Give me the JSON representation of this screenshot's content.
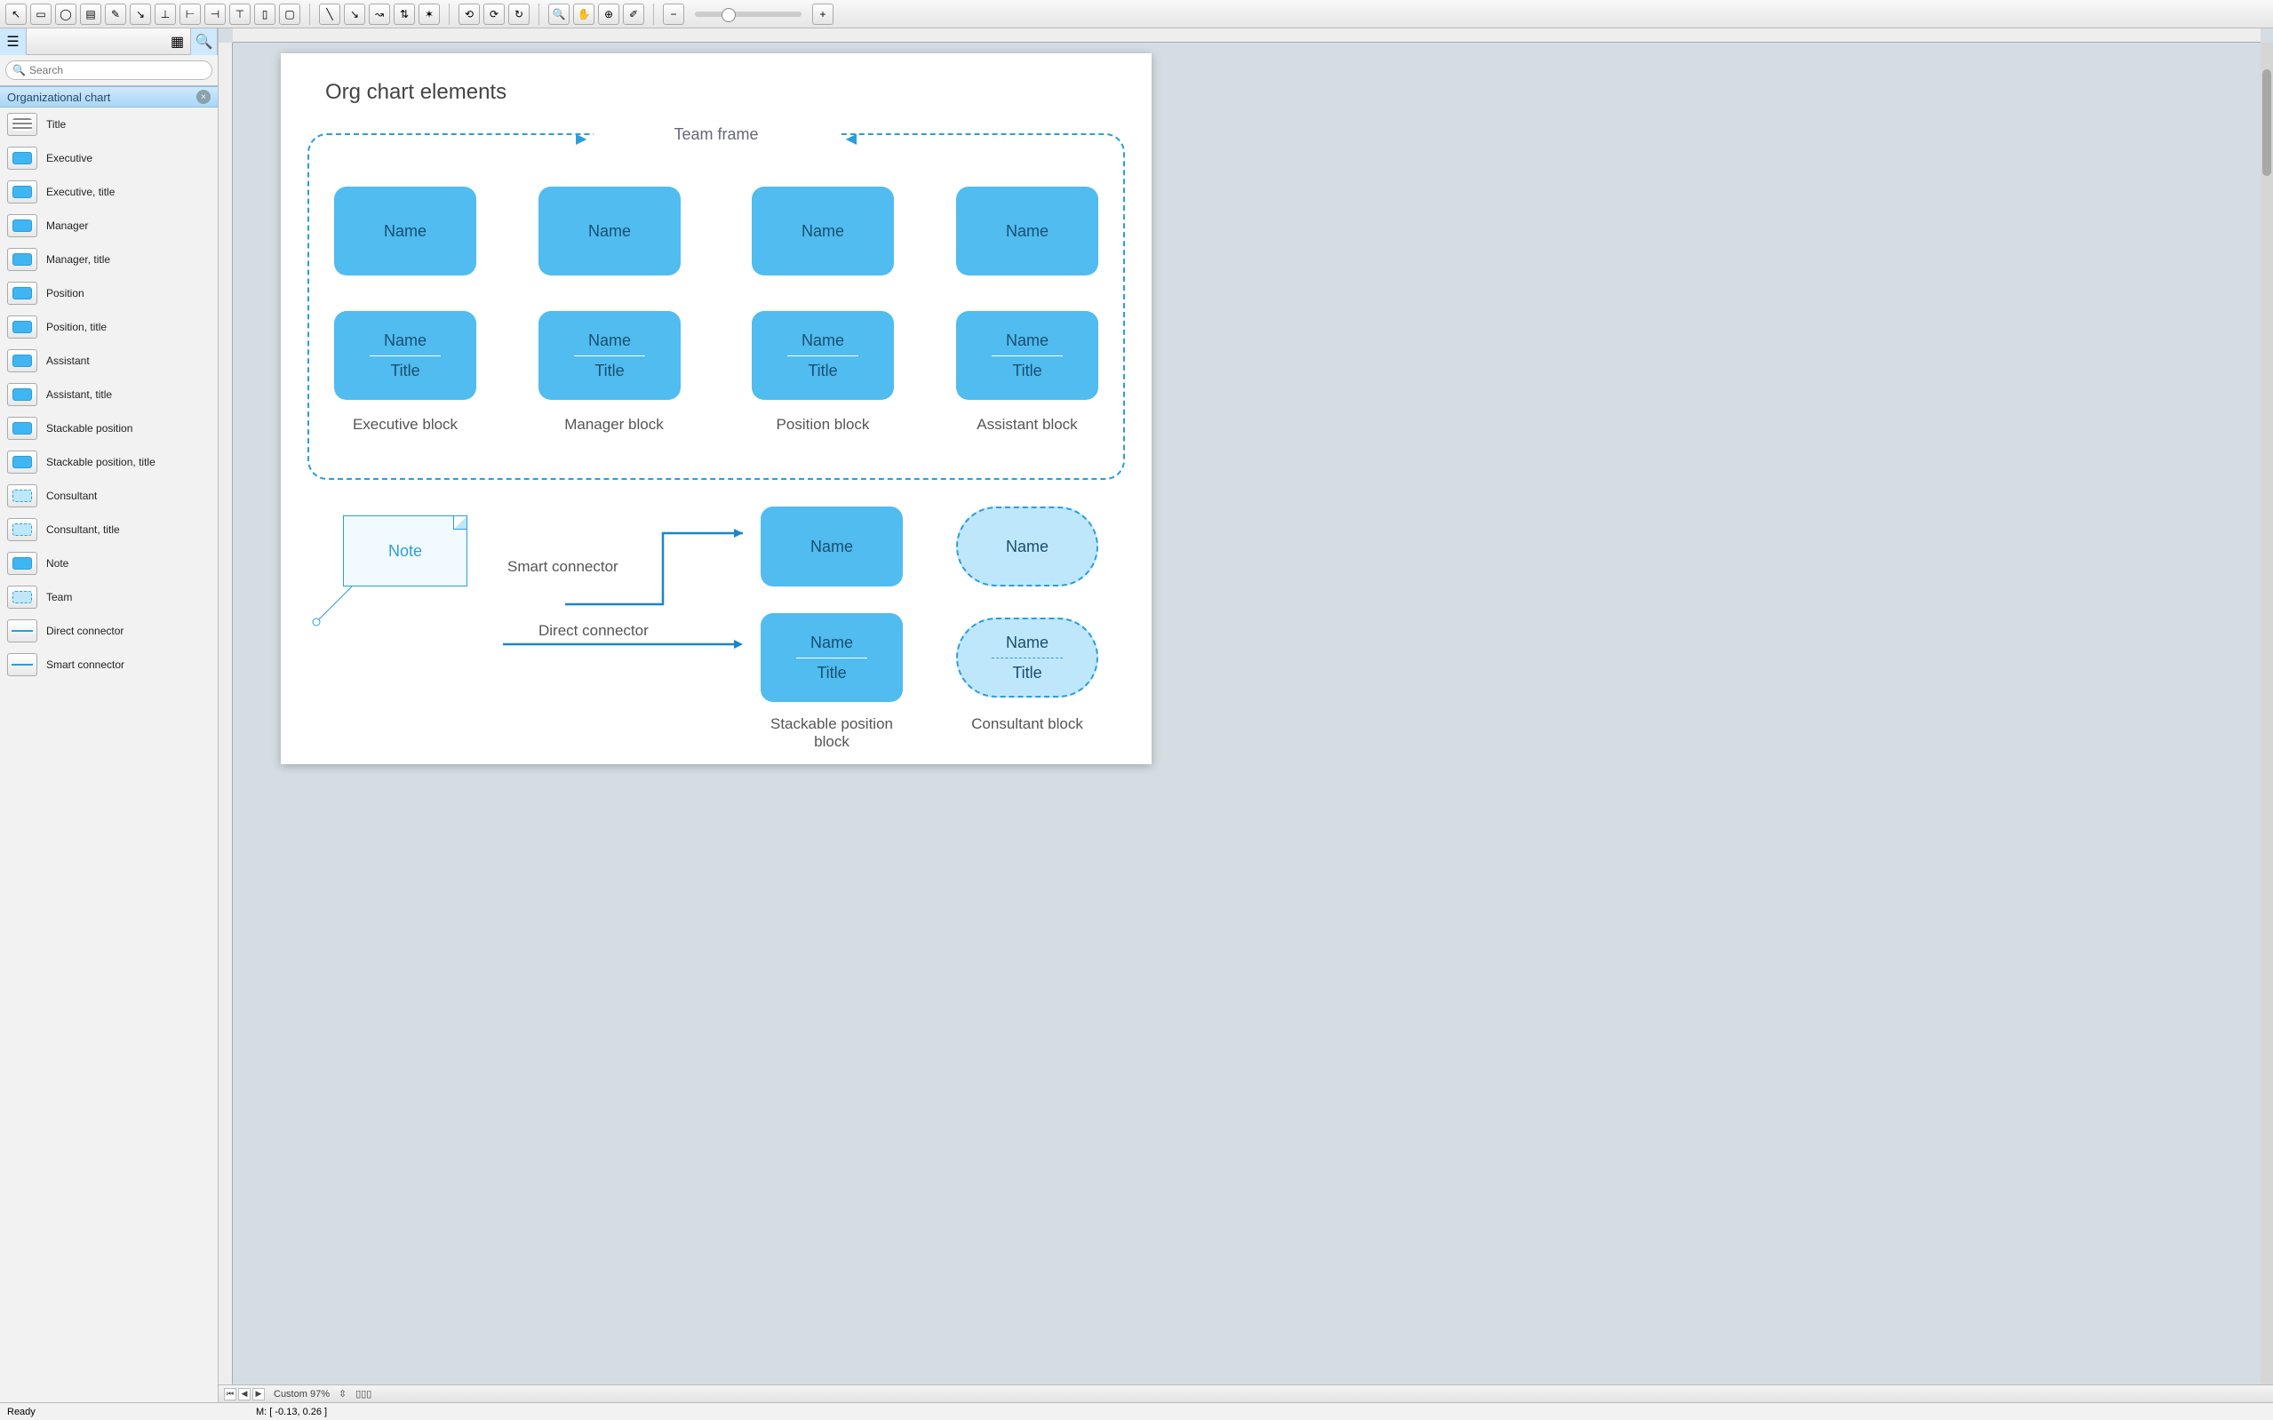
{
  "sidebar": {
    "panel_title": "Organizational chart",
    "search_placeholder": "Search",
    "items": [
      {
        "label": "Title",
        "style": "bars"
      },
      {
        "label": "Executive",
        "style": "mini"
      },
      {
        "label": "Executive, title",
        "style": "mini"
      },
      {
        "label": "Manager",
        "style": "mini"
      },
      {
        "label": "Manager, title",
        "style": "mini"
      },
      {
        "label": "Position",
        "style": "mini"
      },
      {
        "label": "Position, title",
        "style": "mini"
      },
      {
        "label": "Assistant",
        "style": "mini"
      },
      {
        "label": "Assistant, title",
        "style": "mini"
      },
      {
        "label": "Stackable position",
        "style": "mini"
      },
      {
        "label": "Stackable position, title",
        "style": "mini"
      },
      {
        "label": "Consultant",
        "style": "dash"
      },
      {
        "label": "Consultant, title",
        "style": "dash"
      },
      {
        "label": "Note",
        "style": "mini"
      },
      {
        "label": "Team",
        "style": "dash"
      },
      {
        "label": "Direct connector",
        "style": "line"
      },
      {
        "label": "Smart connector",
        "style": "line"
      }
    ]
  },
  "page": {
    "title": "Org chart elements",
    "team_frame_label": "Team frame",
    "name_text": "Name",
    "title_text": "Title",
    "captions": {
      "exec": "Executive block",
      "mgr": "Manager block",
      "pos": "Position block",
      "asst": "Assistant block",
      "stack": "Stackable position block",
      "cons": "Consultant block"
    },
    "note_text": "Note",
    "smart_conn": "Smart connector",
    "direct_conn": "Direct connector"
  },
  "docbar": {
    "zoom": "Custom 97%"
  },
  "status": {
    "ready": "Ready",
    "mouse": "M: [ -0.13, 0.26 ]"
  }
}
